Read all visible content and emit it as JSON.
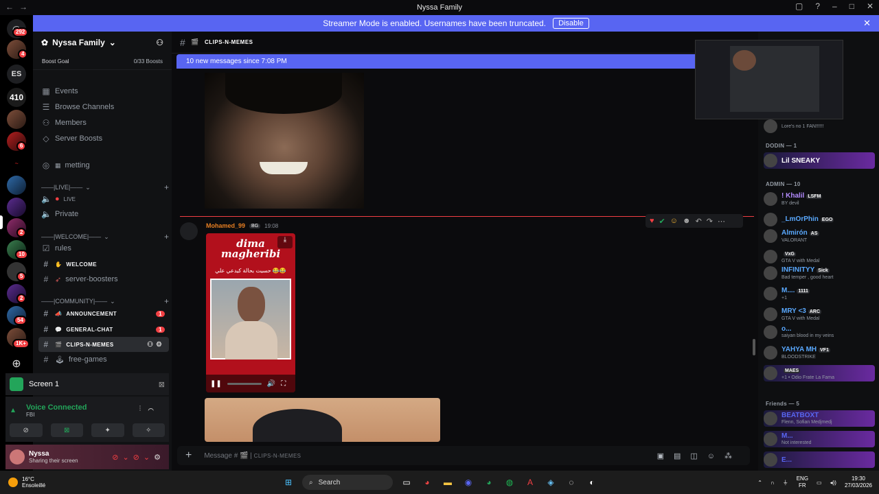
{
  "window": {
    "title": "Nyssa Family"
  },
  "banner": {
    "text": "Streamer Mode is enabled. Usernames have been truncated.",
    "button": "Disable"
  },
  "rail": {
    "badges": [
      "292",
      "4",
      "6",
      "2",
      "10",
      "5",
      "2",
      "54",
      "1K+"
    ],
    "text_server": "ES"
  },
  "server": {
    "name": "Nyssa Family",
    "boost_label": "Boost Goal",
    "boost_value": "0/33 Boosts"
  },
  "nav": [
    "Events",
    "Browse Channels",
    "Members",
    "Server Boosts"
  ],
  "channels": {
    "metting": "metting",
    "cat_live": "——|LIVE|——",
    "live": "LIVE",
    "private": "Private",
    "cat_welcome": "——|WELCOME|——",
    "rules": "rules",
    "welcome": "WELCOME",
    "boosters": "server-boosters",
    "cat_community": "——|COMMUNITY|——",
    "announcement": "ANNOUNCEMENT",
    "announcement_badge": "1",
    "general": "GENERAL-CHAT",
    "general_badge": "1",
    "clips": "CLIPS-N-MEMES",
    "games": "free-games"
  },
  "screen": {
    "label": "Screen 1"
  },
  "voice": {
    "status": "Voice Connected",
    "channel": "FBI"
  },
  "user": {
    "name": "Nyssa",
    "status": "Sharing their screen"
  },
  "chat": {
    "channel": "CLIPS-N-MEMES",
    "new_messages": "10 new messages since 7:08 PM",
    "message": {
      "author": "Mohamed_99",
      "tag": "BG",
      "time": "19:08"
    },
    "video": {
      "title_line1": "dima",
      "title_line2": "magheribi",
      "arabic": "حسيت بحالة كيدعي علي 😂😂"
    },
    "composer_placeholder": "Message #",
    "composer_channel": "CLIPS-N-MEMES"
  },
  "members": {
    "top_activity": "Lore's no 1 FAN!!!!!!",
    "group1": "DODIN — 1",
    "dodin": [
      {
        "name": "Lil SNEAKY",
        "color": "#e0c7ff"
      }
    ],
    "group2": "ADMIN — 10",
    "admins": [
      {
        "name": "! Khalil",
        "tag": "LSFM",
        "activity": "BY devil",
        "color": "#b48bff"
      },
      {
        "name": "_LmOrPhin",
        "tag": "EGO",
        "activity": "",
        "color": "#5aa9ff"
      },
      {
        "name": "Almirón",
        "tag": "AS",
        "activity": "VALORANT",
        "color": "#5aa9ff"
      },
      {
        "name": "",
        "tag": "VxG",
        "activity": "GTA V with Medal",
        "color": "#5aa9ff"
      },
      {
        "name": "INFINITYY",
        "tag": "Sick",
        "activity": "Bad temper , good heart",
        "color": "#5aa9ff"
      },
      {
        "name": "M....",
        "tag": "1111",
        "activity": "+1",
        "color": "#5aa9ff"
      },
      {
        "name": "MRY <3",
        "tag": "ARC",
        "activity": "GTA V with Medal",
        "color": "#5aa9ff"
      },
      {
        "name": "o...",
        "tag": "",
        "activity": "saiyan blood in my veins",
        "color": "#5aa9ff"
      },
      {
        "name": "YAHYA MH",
        "tag": "VF1",
        "activity": "BLOODSTRIKE",
        "color": "#5aa9ff"
      },
      {
        "name": "",
        "tag": "MAES",
        "activity": "+1 • Odio Frate La Fama",
        "color": "#5aa9ff"
      }
    ],
    "group3": "Friends — 5",
    "friends": [
      {
        "name": "BEATBOXT",
        "activity": "Flenn, Sofian Medjmedj",
        "color": "#5865f2"
      },
      {
        "name": "M...",
        "activity": "Not interested",
        "color": "#5865f2"
      },
      {
        "name": "E...",
        "activity": "",
        "color": "#5865f2"
      }
    ]
  },
  "taskbar": {
    "temp": "16°C",
    "weather": "Ensoleillé",
    "search": "Search",
    "lang1": "ENG",
    "lang2": "FR",
    "time": "19:30",
    "date": "27/03/2026"
  }
}
